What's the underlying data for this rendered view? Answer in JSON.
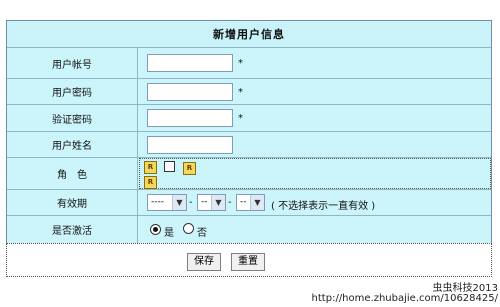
{
  "form": {
    "title": "新增用户信息",
    "rows": {
      "account": {
        "label": "用户帐号",
        "value": "",
        "required": "*"
      },
      "password": {
        "label": "用户密码",
        "value": "",
        "required": "*"
      },
      "confirm": {
        "label": "验证密码",
        "value": "",
        "required": "*"
      },
      "name": {
        "label": "用户姓名",
        "value": ""
      },
      "role": {
        "label": "角　色"
      },
      "expiry": {
        "label": "有效期",
        "year": "----",
        "month": "--",
        "day": "--",
        "separator": "-",
        "hint": "( 不选择表示一直有效 )"
      },
      "active": {
        "label": "是否激活",
        "yes": "是",
        "no": "否",
        "selected": "是"
      }
    },
    "buttons": {
      "save": "保存",
      "reset": "重置"
    }
  },
  "watermark": {
    "line1": "虫虫科技2013",
    "line2": "http://home.zhubajie.com/10628425/"
  },
  "icons": {
    "role_icon": "role-icon",
    "dropdown_arrow": "chevron-down-icon"
  }
}
